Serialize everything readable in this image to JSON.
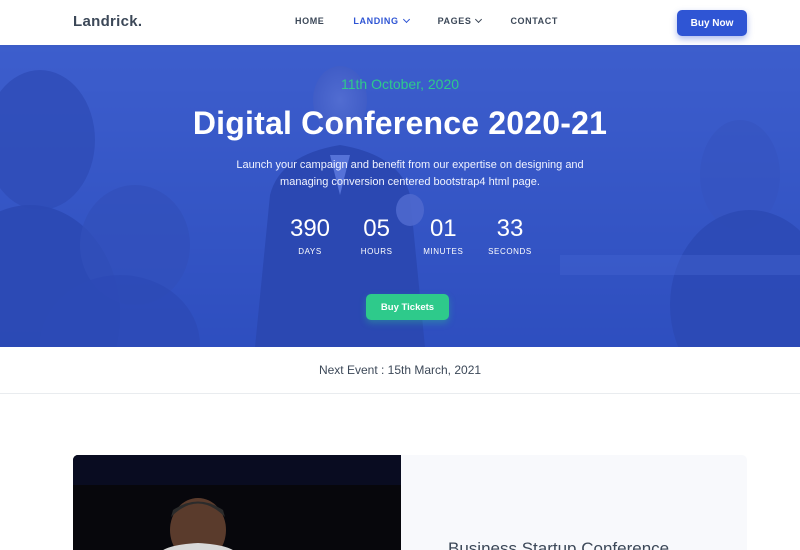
{
  "navbar": {
    "logo": "Landrick.",
    "items": [
      {
        "label": "HOME",
        "active": false,
        "dropdown": false
      },
      {
        "label": "LANDING",
        "active": true,
        "dropdown": true
      },
      {
        "label": "PAGES",
        "active": false,
        "dropdown": true
      },
      {
        "label": "CONTACT",
        "active": false,
        "dropdown": false
      }
    ],
    "cta_label": "Buy Now"
  },
  "hero": {
    "date": "11th October, 2020",
    "title": "Digital Conference 2020-21",
    "description": "Launch your campaign and benefit from our expertise on designing and managing conversion centered bootstrap4 html page.",
    "countdown": [
      {
        "value": "390",
        "label": "DAYS"
      },
      {
        "value": "05",
        "label": "HOURS"
      },
      {
        "value": "01",
        "label": "MINUTES"
      },
      {
        "value": "33",
        "label": "SECONDS"
      }
    ],
    "cta_label": "Buy Tickets"
  },
  "next_event": {
    "text": "Next Event : 15th March, 2021"
  },
  "feature": {
    "title": "Business Startup Conference"
  },
  "colors": {
    "primary": "#2f55d4",
    "success": "#2eca8b",
    "dark": "#3c4858"
  }
}
